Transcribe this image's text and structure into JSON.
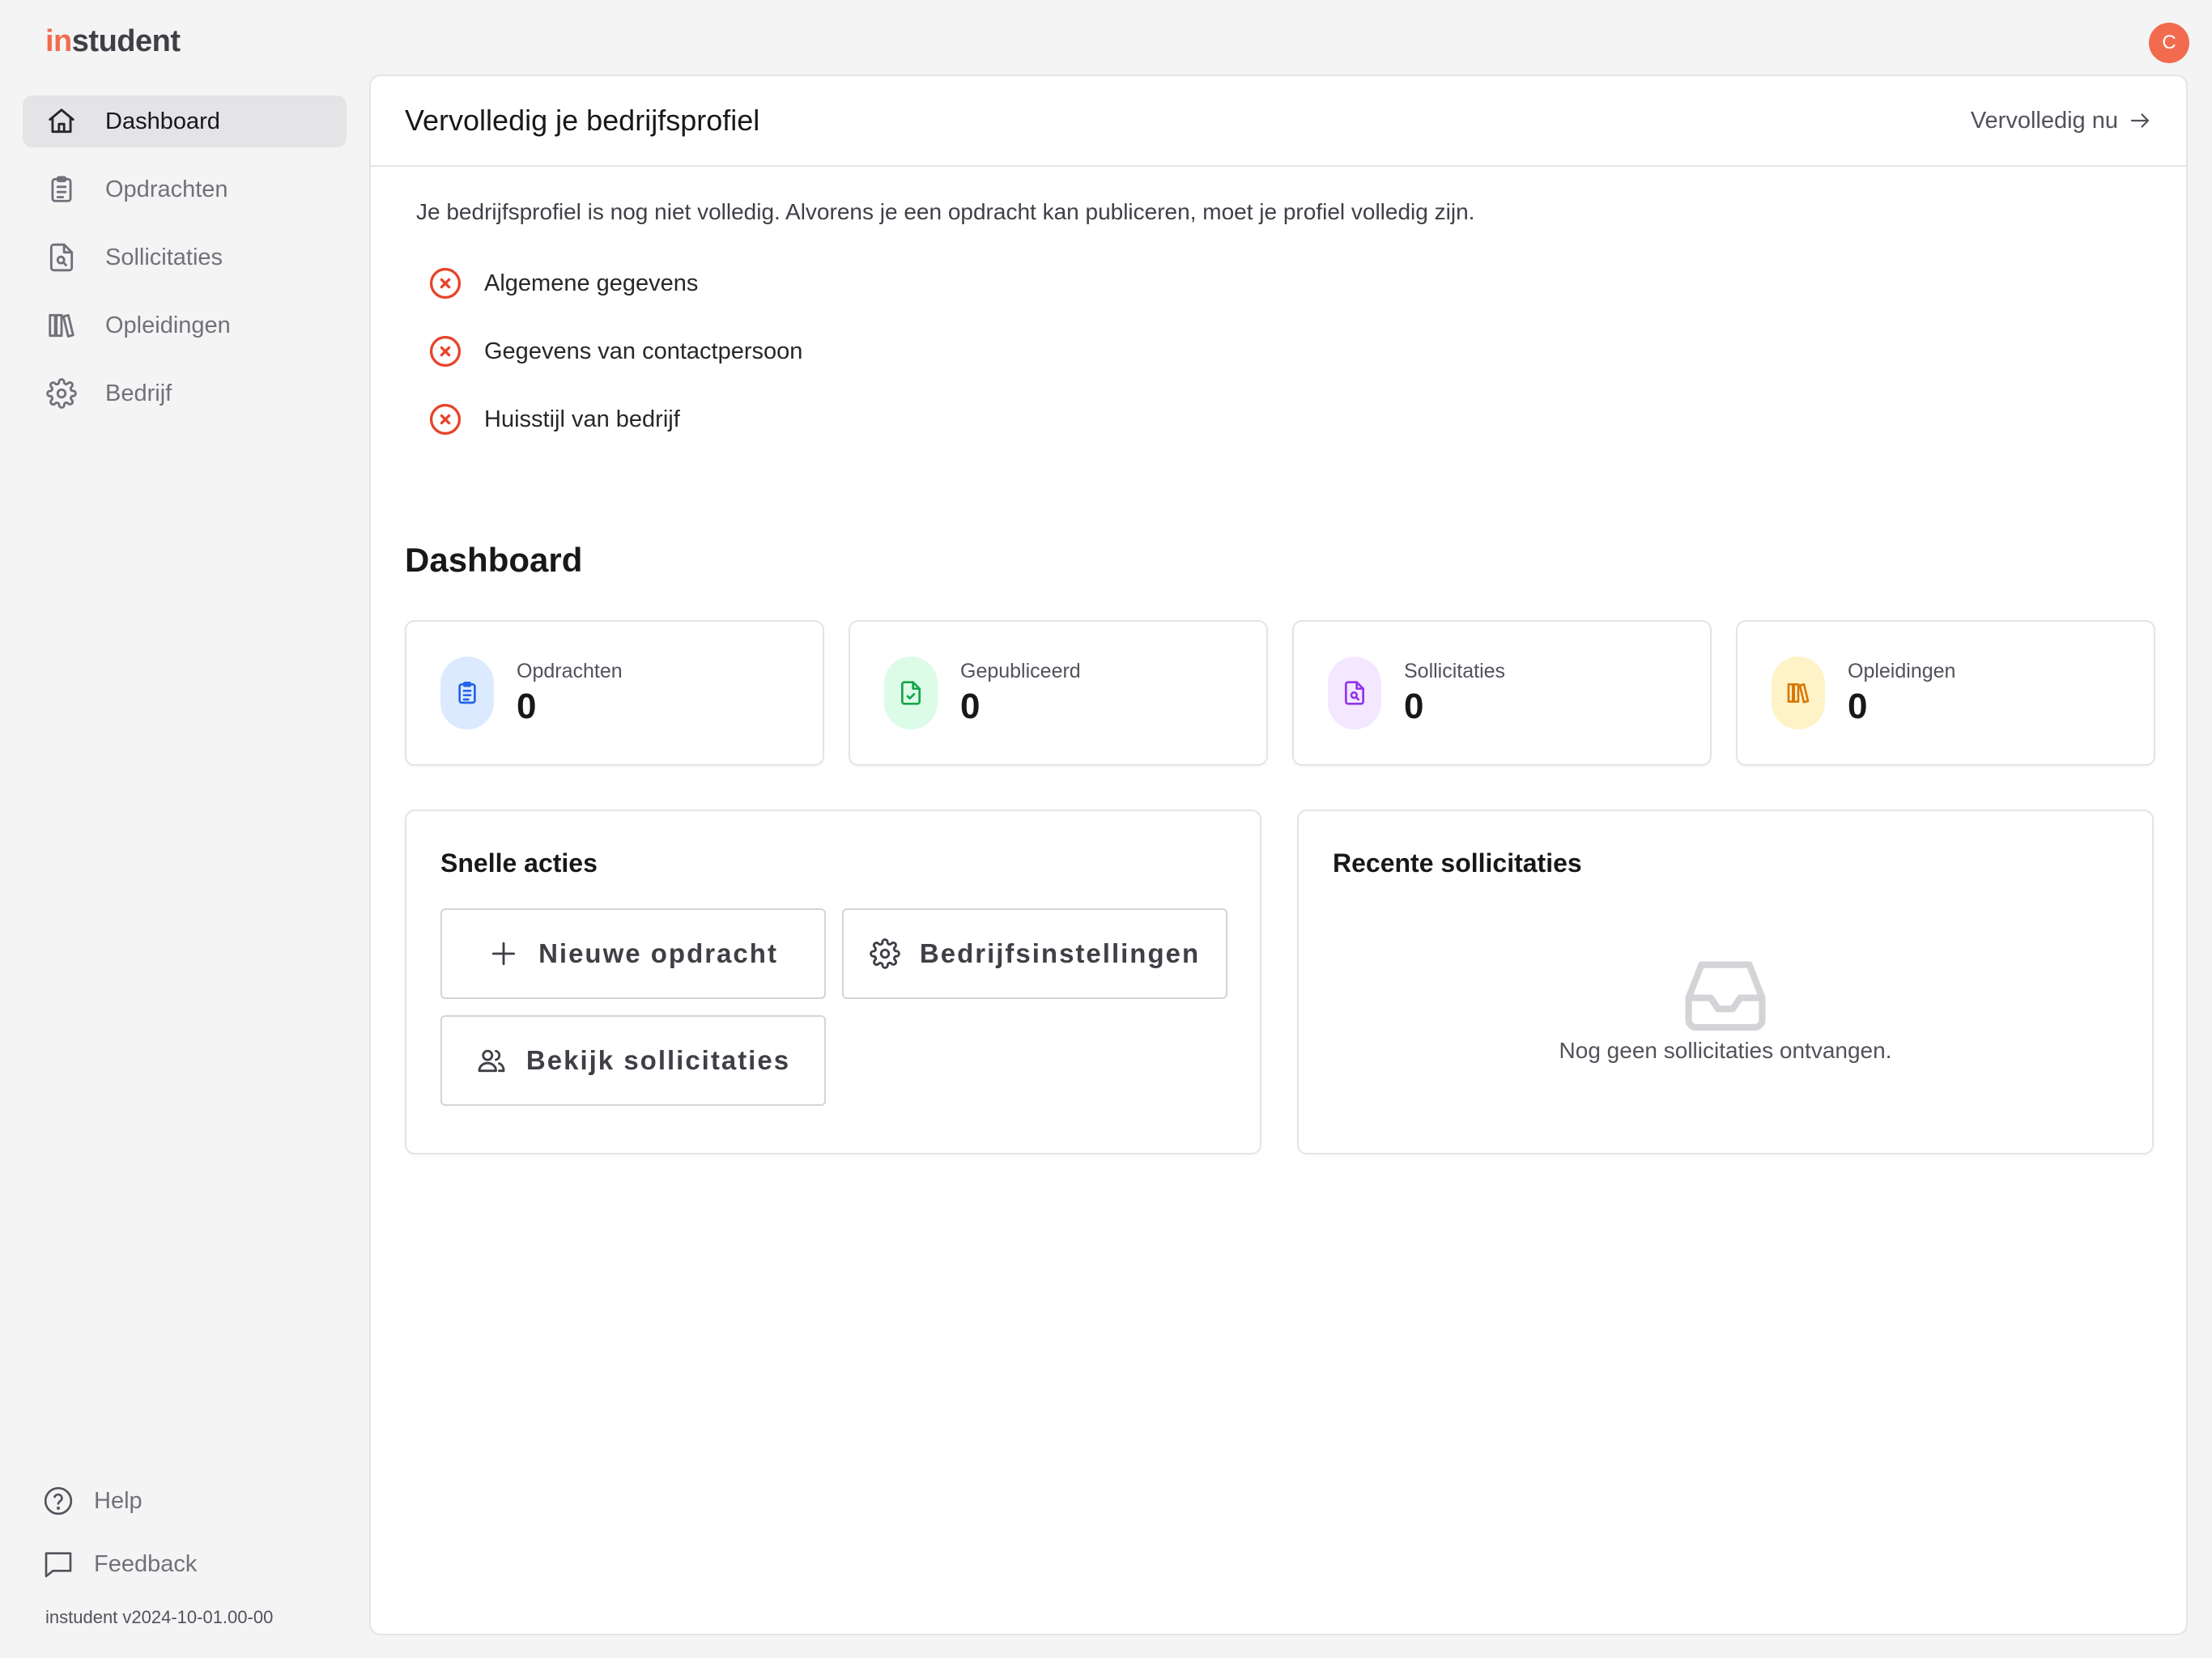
{
  "app": {
    "logo_accent": "in",
    "logo_rest": "student",
    "avatar_initial": "C",
    "accent_color": "#f26b4f"
  },
  "sidebar": {
    "items": [
      {
        "label": "Dashboard",
        "icon": "home-icon",
        "active": true
      },
      {
        "label": "Opdrachten",
        "icon": "clipboard-icon"
      },
      {
        "label": "Sollicitaties",
        "icon": "file-search-icon"
      },
      {
        "label": "Opleidingen",
        "icon": "library-icon"
      },
      {
        "label": "Bedrijf",
        "icon": "gear-icon"
      }
    ],
    "bottom": [
      {
        "label": "Help",
        "icon": "help-circle-icon"
      },
      {
        "label": "Feedback",
        "icon": "message-square-icon"
      }
    ],
    "version": "instudent v2024-10-01.00-00"
  },
  "profile": {
    "title": "Vervolledig je bedrijfsprofiel",
    "action_label": "Vervolledig nu",
    "description": "Je bedrijfsprofiel is nog niet volledig. Alvorens je een opdracht kan publiceren, moet je profiel volledig zijn.",
    "checklist": [
      {
        "label": "Algemene gegevens",
        "status": "incomplete"
      },
      {
        "label": "Gegevens van contactpersoon",
        "status": "incomplete"
      },
      {
        "label": "Huisstijl van bedrijf",
        "status": "incomplete"
      }
    ]
  },
  "dashboard": {
    "title": "Dashboard",
    "stats": [
      {
        "label": "Opdrachten",
        "value": "0",
        "icon": "clipboard-icon",
        "color": "#2563eb",
        "bg": "#dbeafe"
      },
      {
        "label": "Gepubliceerd",
        "value": "0",
        "icon": "file-check-icon",
        "color": "#16a34a",
        "bg": "#dcfce7"
      },
      {
        "label": "Sollicitaties",
        "value": "0",
        "icon": "file-search-icon",
        "color": "#9333ea",
        "bg": "#f3e8ff"
      },
      {
        "label": "Opleidingen",
        "value": "0",
        "icon": "library-icon",
        "color": "#d97706",
        "bg": "#fef3c7"
      }
    ]
  },
  "quick_actions": {
    "title": "Snelle acties",
    "new_assignment": "Nieuwe opdracht",
    "company_settings": "Bedrijfsinstellingen",
    "view_applications": "Bekijk sollicitaties"
  },
  "recent": {
    "title": "Recente sollicitaties",
    "empty_text": "Nog geen sollicitaties ontvangen.",
    "empty_icon": "inbox-icon"
  }
}
